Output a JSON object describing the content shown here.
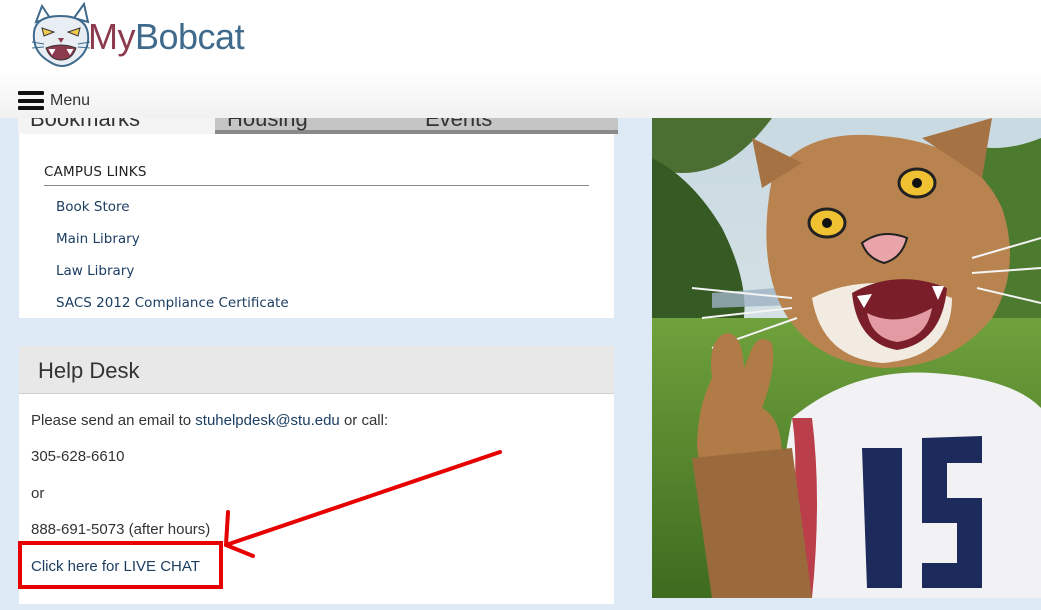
{
  "header": {
    "brand_my": "My",
    "brand_bobcat": "Bobcat",
    "menu_label": "Menu"
  },
  "tabs": [
    {
      "label": "Bookmarks"
    },
    {
      "label": "Housing"
    },
    {
      "label": "Events"
    }
  ],
  "campus_links": {
    "heading": "CAMPUS LINKS",
    "items": [
      {
        "label": "Book Store"
      },
      {
        "label": "Main Library"
      },
      {
        "label": "Law Library"
      },
      {
        "label": "SACS 2012 Compliance Certificate"
      }
    ]
  },
  "help_desk": {
    "title": "Help Desk",
    "email_prefix": "Please send an email to ",
    "email": "stuhelpdesk@stu.edu",
    "email_suffix": " or call:",
    "phone1": "305-628-6610",
    "or_text": "or",
    "phone2": "888-691-5073 (after hours)",
    "live_chat": "Click here for LIVE CHAT"
  },
  "colors": {
    "brand_my": "#8c3a4d",
    "brand_bobcat": "#3f6a8c",
    "link": "#1c3e62",
    "page_bg": "#dde9f5",
    "annotation": "#e60000"
  },
  "icons": {
    "logo": "bobcat-logo-icon",
    "menu": "hamburger-icon"
  }
}
